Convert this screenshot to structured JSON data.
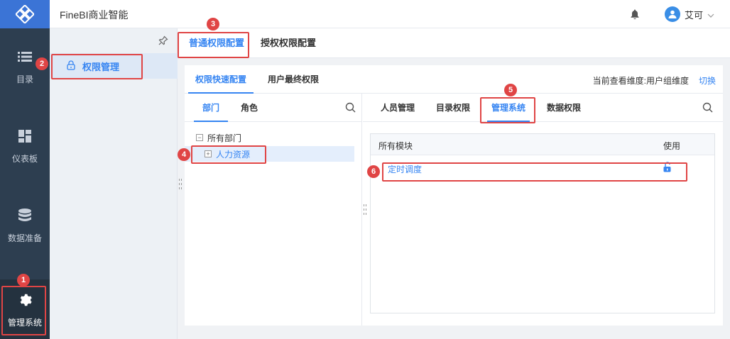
{
  "app": {
    "title": "FineBI商业智能"
  },
  "header": {
    "user_name": "艾可"
  },
  "rail": {
    "items": [
      {
        "label": "目录",
        "icon": "list-icon"
      },
      {
        "label": "仪表板",
        "icon": "dashboard-icon"
      },
      {
        "label": "数据准备",
        "icon": "database-icon"
      },
      {
        "label": "管理系统",
        "icon": "gear-icon"
      }
    ]
  },
  "sidebar": {
    "active_item": "权限管理"
  },
  "top_tabs": [
    "普通权限配置",
    "授权权限配置"
  ],
  "sub_tabs": [
    "权限快速配置",
    "用户最终权限"
  ],
  "dimension": {
    "label": "当前查看维度:用户组维度",
    "switch_label": "切换"
  },
  "left_pane": {
    "tabs": [
      "部门",
      "角色"
    ],
    "tree": {
      "root": "所有部门",
      "child": "人力资源"
    }
  },
  "right_pane": {
    "tabs": [
      "人员管理",
      "目录权限",
      "管理系统",
      "数据权限"
    ],
    "table": {
      "headers": [
        "所有模块",
        "使用"
      ],
      "rows": [
        {
          "module": "定时调度"
        }
      ]
    }
  },
  "annotations": [
    "1",
    "2",
    "3",
    "4",
    "5",
    "6"
  ],
  "colors": {
    "accent": "#3685f2",
    "rail_bg": "#2d3e50",
    "highlight": "#e04545"
  }
}
